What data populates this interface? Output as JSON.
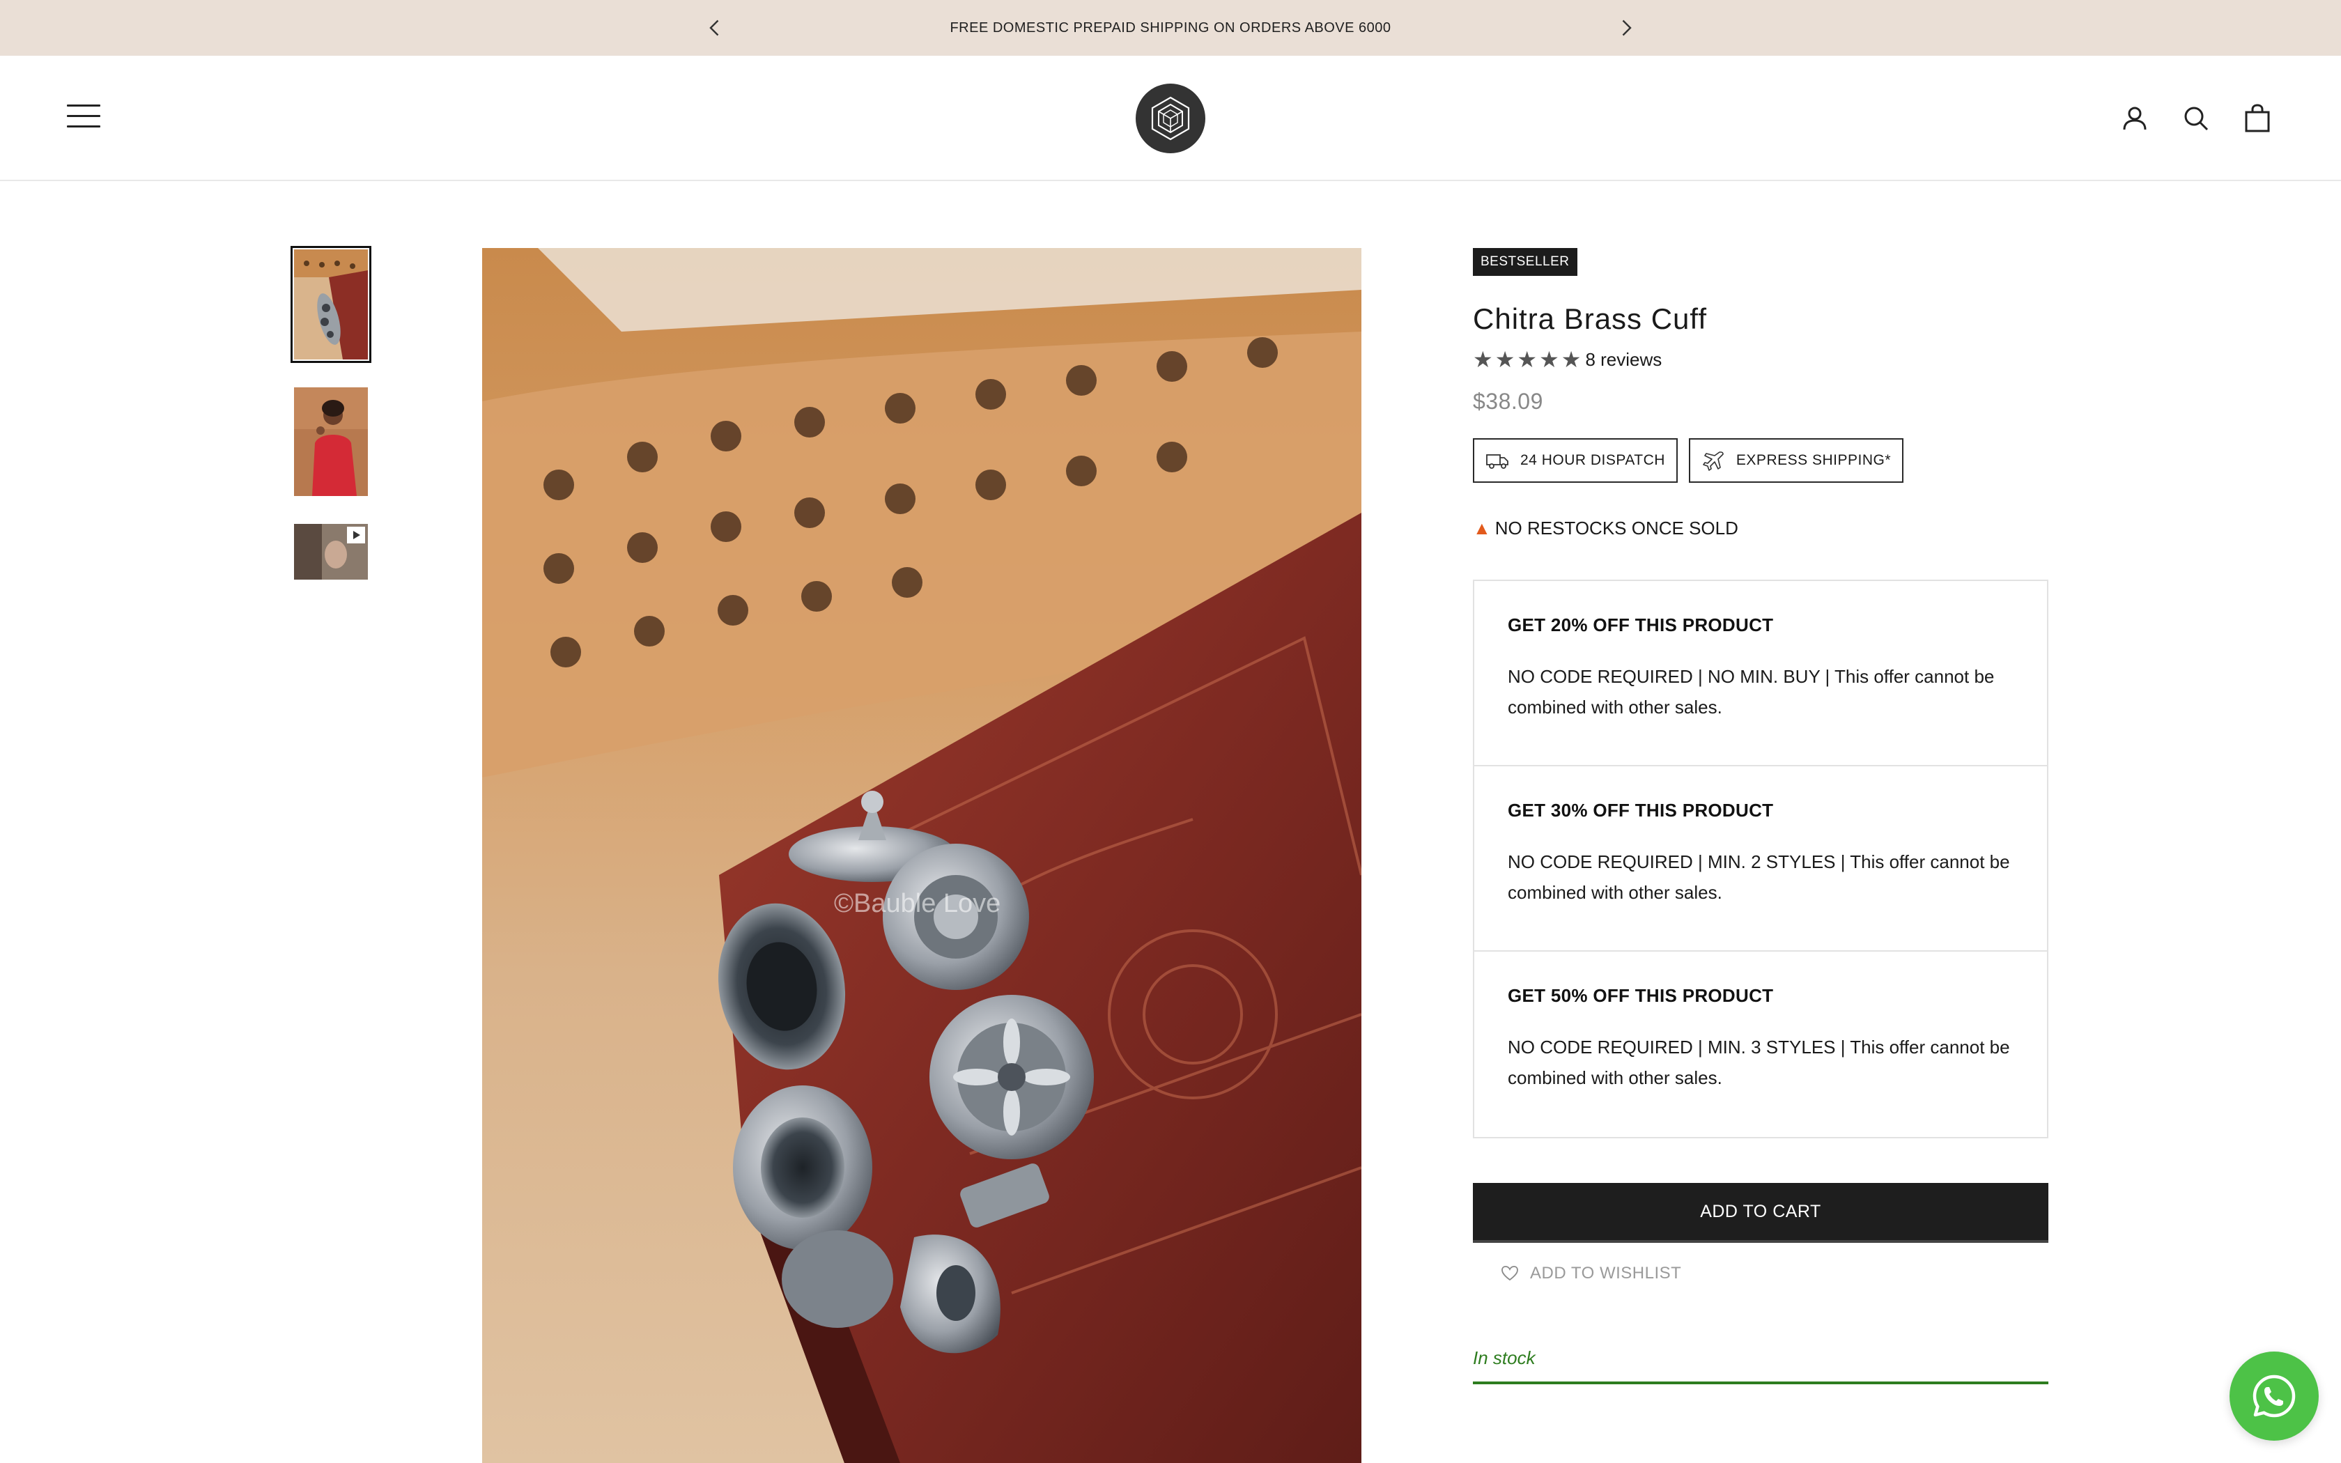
{
  "announcement": {
    "text": "FREE DOMESTIC PREPAID SHIPPING ON ORDERS ABOVE 6000",
    "prev_icon": "chevron-left-icon",
    "next_icon": "chevron-right-icon"
  },
  "header": {
    "menu_icon": "hamburger-menu-icon",
    "logo_icon": "hexagon-logo-icon",
    "icons": [
      "account-icon",
      "search-icon",
      "shopping-bag-icon"
    ]
  },
  "gallery": {
    "thumbnails": [
      {
        "name": "thumbnail-cuff-on-book",
        "active": true
      },
      {
        "name": "thumbnail-model-red-outfit",
        "active": false
      },
      {
        "name": "thumbnail-video",
        "active": false,
        "icon": "play-icon"
      }
    ],
    "watermark": "©Bauble Love"
  },
  "product": {
    "badge": "BESTSELLER",
    "title": "Chitra Brass Cuff",
    "rating": 5,
    "reviews": "8 reviews",
    "price": "$38.09",
    "features": [
      {
        "label": "24 HOUR DISPATCH",
        "icon": "delivery-truck-icon"
      },
      {
        "label": "EXPRESS SHIPPING*",
        "icon": "airplane-icon"
      }
    ],
    "no_restocks": "NO RESTOCKS ONCE SOLD",
    "no_restocks_icon": "fire-icon",
    "offers": [
      {
        "title": "GET 20% OFF THIS PRODUCT",
        "description": "NO CODE REQUIRED | NO MIN. BUY | This offer cannot be combined with other sales."
      },
      {
        "title": "GET 30% OFF THIS PRODUCT",
        "description": "NO CODE REQUIRED | MIN. 2 STYLES | This offer cannot be combined with other sales."
      },
      {
        "title": "GET 50% OFF THIS PRODUCT",
        "description": "NO CODE REQUIRED | MIN. 3 STYLES | This offer cannot be combined with other sales."
      }
    ],
    "add_to_cart": "ADD TO CART",
    "add_to_wishlist": "ADD TO WISHLIST",
    "wishlist_icon": "heart-icon",
    "stock_status": "In stock"
  },
  "chat": {
    "icon": "whatsapp-icon"
  },
  "colors": {
    "announcement_bg": "#eadfd6",
    "button_bg": "#1e1e1e",
    "in_stock": "#2e7d1f",
    "whatsapp": "#4dc247"
  }
}
